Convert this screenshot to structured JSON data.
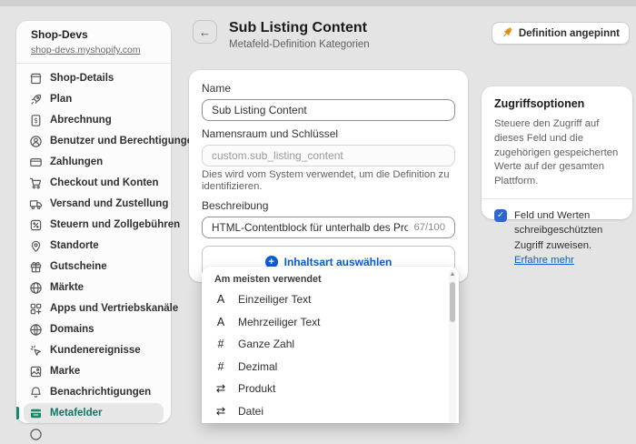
{
  "icons": {
    "back": "←",
    "plus": "+",
    "check": "✓",
    "scroll_up": "▲"
  },
  "colors": {
    "accent_green": "#17866a",
    "selected_nav_text": "#0a7a63",
    "link_blue": "#0b5cd7",
    "checkbox_blue": "#2c68cf",
    "pin_amber": "#dd8d12",
    "page_background": "#e4e4e4"
  },
  "sidebar": {
    "store_name": "Shop-Devs",
    "store_domain": "shop-devs.myshopify.com",
    "items": [
      {
        "id": "shop-details",
        "label": "Shop-Details",
        "icon": "store-icon",
        "selected": false
      },
      {
        "id": "plan",
        "label": "Plan",
        "icon": "plan-icon",
        "selected": false
      },
      {
        "id": "abrechnung",
        "label": "Abrechnung",
        "icon": "billing-icon",
        "selected": false
      },
      {
        "id": "benutzer",
        "label": "Benutzer und Berechtigungen",
        "icon": "users-icon",
        "selected": false
      },
      {
        "id": "zahlungen",
        "label": "Zahlungen",
        "icon": "payments-icon",
        "selected": false
      },
      {
        "id": "checkout",
        "label": "Checkout und Konten",
        "icon": "checkout-icon",
        "selected": false
      },
      {
        "id": "versand",
        "label": "Versand und Zustellung",
        "icon": "shipping-icon",
        "selected": false
      },
      {
        "id": "steuern",
        "label": "Steuern und Zollgebühren",
        "icon": "taxes-icon",
        "selected": false
      },
      {
        "id": "standorte",
        "label": "Standorte",
        "icon": "locations-icon",
        "selected": false
      },
      {
        "id": "gutscheine",
        "label": "Gutscheine",
        "icon": "gift-icon",
        "selected": false
      },
      {
        "id": "maerkte",
        "label": "Märkte",
        "icon": "globe-icon",
        "selected": false
      },
      {
        "id": "apps",
        "label": "Apps und Vertriebskanäle",
        "icon": "apps-icon",
        "selected": false
      },
      {
        "id": "domains",
        "label": "Domains",
        "icon": "domains-icon",
        "selected": false
      },
      {
        "id": "kundenereignisse",
        "label": "Kundenereignisse",
        "icon": "customer-events-icon",
        "selected": false
      },
      {
        "id": "marke",
        "label": "Marke",
        "icon": "brand-icon",
        "selected": false
      },
      {
        "id": "benachrichtigungen",
        "label": "Benachrichtigungen",
        "icon": "bell-icon",
        "selected": false
      },
      {
        "id": "metafelder",
        "label": "Metafelder",
        "icon": "metafields-icon",
        "selected": true
      },
      {
        "id": "partial",
        "label": "",
        "icon": "circle-icon",
        "selected": false
      }
    ]
  },
  "header": {
    "title": "Sub Listing Content",
    "subtitle": "Metafeld-Definition Kategorien",
    "pinned_button": "Definition angepinnt"
  },
  "form": {
    "name_label": "Name",
    "name_value": "Sub Listing Content",
    "namespace_label": "Namensraum und Schlüssel",
    "namespace_value": "custom.sub_listing_content",
    "namespace_help": "Dies wird vom System verwendet, um die Definition zu identifizieren.",
    "description_label": "Beschreibung",
    "description_value": "HTML-Contentblock für unterhalb des Produktlistings in Collecti",
    "description_counter": "67/100",
    "content_type_button": "Inhaltsart auswählen"
  },
  "dropdown": {
    "group_label": "Am meisten verwendet",
    "items": [
      {
        "label": "Einzeiliger Text",
        "icon": "single-line-text-icon",
        "glyph": "A"
      },
      {
        "label": "Mehrzeiliger Text",
        "icon": "multi-line-text-icon",
        "glyph": "A"
      },
      {
        "label": "Ganze Zahl",
        "icon": "integer-icon",
        "glyph": "#"
      },
      {
        "label": "Dezimal",
        "icon": "decimal-icon",
        "glyph": "#"
      },
      {
        "label": "Produkt",
        "icon": "product-reference-icon",
        "glyph": "⇄"
      },
      {
        "label": "Datei",
        "icon": "file-reference-icon",
        "glyph": "⇄"
      }
    ]
  },
  "access": {
    "title": "Zugriffsoptionen",
    "description": "Steuere den Zugriff auf dieses Feld und die zugehörigen gespeicherten Werte auf der gesamten Plattform.",
    "checkbox_checked": true,
    "checkbox_label": "Feld und Werten schreibgeschützten Zugriff zuweisen.",
    "learn_more_label": "Erfahre mehr"
  }
}
